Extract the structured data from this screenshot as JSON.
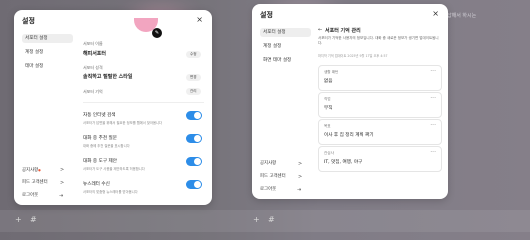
{
  "background": {
    "right_text": "답해서 하시는",
    "plus": "+",
    "hash": "#"
  },
  "modal_left": {
    "title": "설정",
    "close": "×",
    "sidebar": [
      "서포터 설정",
      "계정 설정",
      "테마 설정"
    ],
    "bottom_items": [
      {
        "label": "공지사항",
        "badge": "●",
        "arrow": ">"
      },
      {
        "label": "피드 고객센터",
        "arrow": ">"
      },
      {
        "label": "로그아웃",
        "arrow": "⇥"
      }
    ],
    "name_label": "서포터 이름",
    "name_value": "해피서포터",
    "name_button": "수정",
    "persona_label": "서포터 성격",
    "persona_value": "솔직하고 털털한 스타일",
    "persona_button": "변경",
    "memory_label": "서포터 기억",
    "memory_button": "관리",
    "toggles": [
      {
        "title": "자동 인터넷 검색",
        "desc": "서포터가 답변을 위해서 필요한 정보를 웹에서 찾아봅니다",
        "on": true
      },
      {
        "title": "대화 중 추천 질문",
        "desc": "대화 중에 추천 질문을 표시합니다",
        "on": true
      },
      {
        "title": "대화 중 도구 제안",
        "desc": "서포터가 도구 사용을 제안하도록 허용합니다",
        "on": true
      },
      {
        "title": "뉴스레터 수신",
        "desc": "서포터의 맞춤형 뉴스레터를 받아봅니다",
        "on": true
      }
    ],
    "toggle_color": "#2d8de8"
  },
  "modal_right": {
    "title": "설정",
    "close": "×",
    "sidebar": [
      "서포터 설정",
      "계정 설정",
      "화면 테마 설정"
    ],
    "bottom_items": [
      {
        "label": "공지사항",
        "arrow": ">"
      },
      {
        "label": "피드 고객센터",
        "arrow": ">"
      },
      {
        "label": "로그아웃",
        "arrow": "⇥"
      }
    ],
    "back_arrow": "←",
    "section_title": "서포터 기억 관리",
    "description": "서포터가 기억한 사용자의 정보입니다. 대화 중 새로운 정보가 생기면 업데이트됩니다.",
    "updated": "마지막 기억 업데이트 2025년 9월 17일 오후 4:57",
    "memories": [
      {
        "label": "생활 패턴",
        "value": "없음"
      },
      {
        "label": "직업",
        "value": "무직"
      },
      {
        "label": "목표",
        "value": "이사 후 집 정리 계획 짜기"
      },
      {
        "label": "관심사",
        "value": "IT, 맛집, 여행, 야구"
      }
    ]
  }
}
